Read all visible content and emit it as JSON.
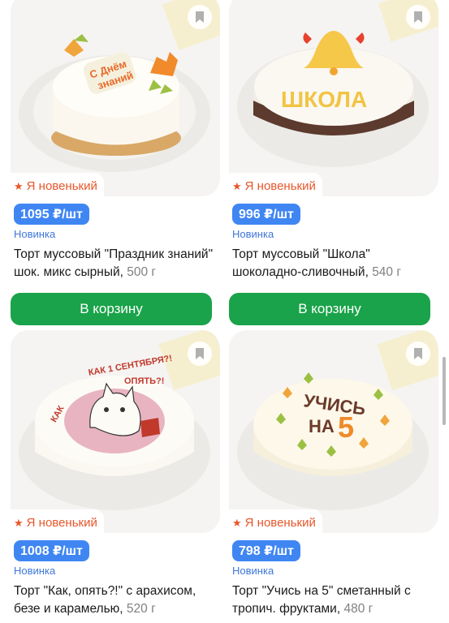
{
  "products": [
    {
      "badge": "Я новенький",
      "price": "1095 ₽/шт",
      "status": "Новинка",
      "title": "Торт муссовый \"Праздник знаний\" шок. микс сырный,",
      "weight": "500 г",
      "button": "В корзину",
      "image_text": [
        "С Днём",
        "знаний"
      ],
      "icon": "bookmark-icon"
    },
    {
      "badge": "Я новенький",
      "price": "996 ₽/шт",
      "status": "Новинка",
      "title": "Торт муссовый \"Школа\" шоколадно-сливочный,",
      "weight": "540 г",
      "button": "В корзину",
      "image_text": [
        "ШКОЛА"
      ],
      "icon": "bookmark-icon"
    },
    {
      "badge": "Я новенький",
      "price": "1008 ₽/шт",
      "status": "Новинка",
      "title": "Торт \"Как, опять?!\" с арахисом, безе и карамелью,",
      "weight": "520 г",
      "image_text": [
        "КАК 1 СЕНТЯБРЯ?!",
        "ОПЯТЬ?!"
      ],
      "icon": "bookmark-icon"
    },
    {
      "badge": "Я новенький",
      "price": "798 ₽/шт",
      "status": "Новинка",
      "title": "Торт \"Учись на 5\" сметанный с тропич. фруктами,",
      "weight": "480 г",
      "image_text": [
        "УЧИСЬ",
        "НА",
        "5"
      ],
      "icon": "bookmark-icon"
    }
  ],
  "colors": {
    "accent_green": "#1aa34a",
    "price_blue": "#3f86f3",
    "badge_orange": "#e8562a",
    "status_blue": "#3f76d9"
  }
}
